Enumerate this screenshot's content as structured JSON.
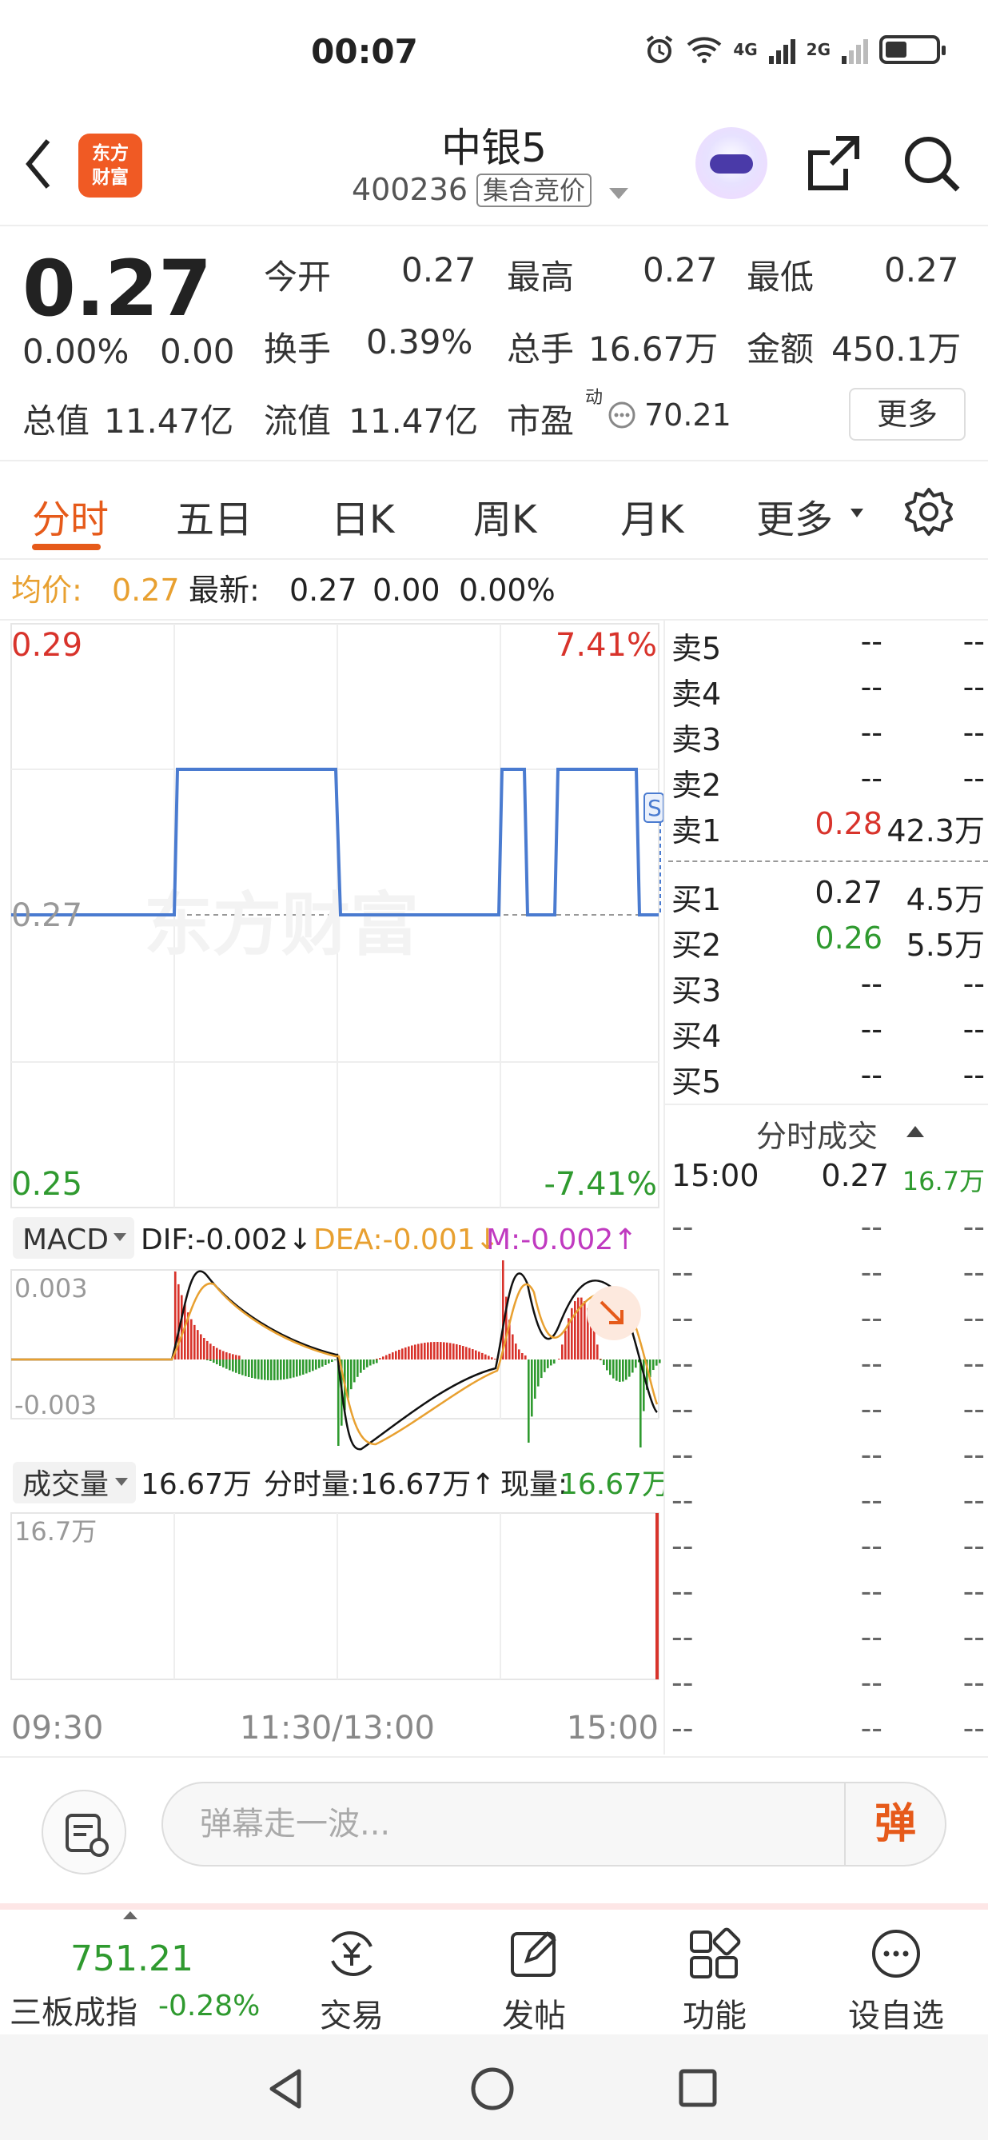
{
  "status_bar": {
    "time": "00:07",
    "net1": "4G",
    "net2": "2G"
  },
  "header": {
    "stock_name": "中银5",
    "stock_code": "400236",
    "market_tag": "集合竞价",
    "logo_text": "东方财富"
  },
  "quote": {
    "price": "0.27",
    "change_pct": "0.00%",
    "change": "0.00",
    "open_label": "今开",
    "open": "0.27",
    "high_label": "最高",
    "high": "0.27",
    "low_label": "最低",
    "low": "0.27",
    "turnover_label": "换手",
    "turnover": "0.39%",
    "volume_label": "总手",
    "volume": "16.67万",
    "amount_label": "金额",
    "amount": "450.1万",
    "mktcap_label": "总值",
    "mktcap": "11.47亿",
    "float_label": "流值",
    "float": "11.47亿",
    "pe_label": "市盈",
    "pe_sup": "动",
    "pe": "70.21",
    "more_label": "更多"
  },
  "tabs": [
    "分时",
    "五日",
    "日K",
    "周K",
    "月K",
    "更多"
  ],
  "avg_bar": {
    "avg_label": "均价:",
    "avg": "0.27",
    "latest_label": "最新:",
    "latest": "0.27",
    "chg": "0.00",
    "pct": "0.00%"
  },
  "main_chart": {
    "y_top": "0.29",
    "y_mid": "0.27",
    "y_bottom": "0.25",
    "pct_top": "7.41%",
    "pct_bottom": "-7.41%",
    "watermark": "东方财富",
    "marker": "S"
  },
  "macd": {
    "selector": "MACD",
    "dif": "DIF:-0.002↓",
    "dea": "DEA:-0.001↓",
    "m": "M:-0.002↑",
    "y_top": "0.003",
    "y_bottom": "-0.003"
  },
  "volume": {
    "selector": "成交量",
    "total": "16.67万",
    "tick_label": "分时量:16.67万↑",
    "now_label": "现量:",
    "now_value": "16.67万",
    "y_top": "16.7万"
  },
  "time_axis": {
    "start": "09:30",
    "mid": "11:30/13:00",
    "end": "15:00"
  },
  "order_book": {
    "asks": [
      {
        "label": "卖5",
        "price": "--",
        "vol": "--"
      },
      {
        "label": "卖4",
        "price": "--",
        "vol": "--"
      },
      {
        "label": "卖3",
        "price": "--",
        "vol": "--"
      },
      {
        "label": "卖2",
        "price": "--",
        "vol": "--"
      },
      {
        "label": "卖1",
        "price": "0.28",
        "vol": "42.3万"
      }
    ],
    "bids": [
      {
        "label": "买1",
        "price": "0.27",
        "vol": "4.5万"
      },
      {
        "label": "买2",
        "price": "0.26",
        "vol": "5.5万"
      },
      {
        "label": "买3",
        "price": "--",
        "vol": "--"
      },
      {
        "label": "买4",
        "price": "--",
        "vol": "--"
      },
      {
        "label": "买5",
        "price": "--",
        "vol": "--"
      }
    ],
    "ticks_title": "分时成交",
    "first_tick": {
      "time": "15:00",
      "price": "0.27",
      "vol": "16.7万"
    },
    "dash": "--"
  },
  "danmu": {
    "placeholder": "弹幕走一波...",
    "button": "弹"
  },
  "bottom_nav": {
    "index_value": "751.21",
    "index_name": "三板成指",
    "index_change": "-0.28%",
    "items": [
      "交易",
      "发帖",
      "功能",
      "设自选"
    ]
  },
  "colors": {
    "accent": "#e65a1a",
    "up": "#d8332b",
    "down": "#2f9a2f",
    "line": "#4a7bd0",
    "avg": "#e8a030"
  }
}
